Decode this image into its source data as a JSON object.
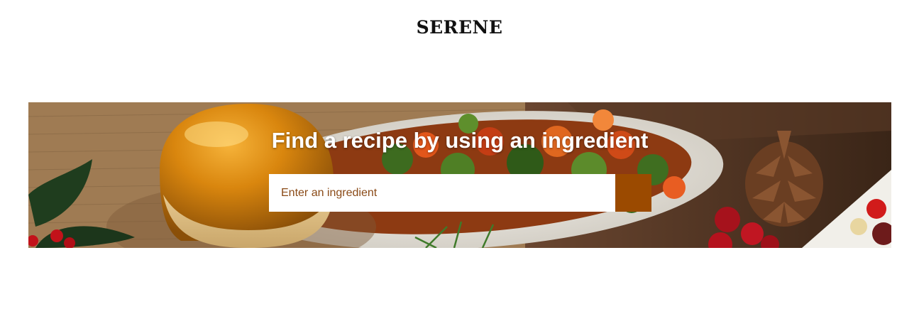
{
  "site": {
    "logo_text": "SERENE"
  },
  "hero": {
    "title": "Find a recipe by using an ingredient",
    "image_description": "food-photo-banner"
  },
  "search": {
    "placeholder": "Enter an ingredient",
    "value": "",
    "button_icon": "search-submit-icon"
  },
  "colors": {
    "accent": "#9b4a00",
    "placeholder_text": "#8a4a17",
    "page_background": "#ffffff",
    "hero_title": "#ffffff"
  }
}
